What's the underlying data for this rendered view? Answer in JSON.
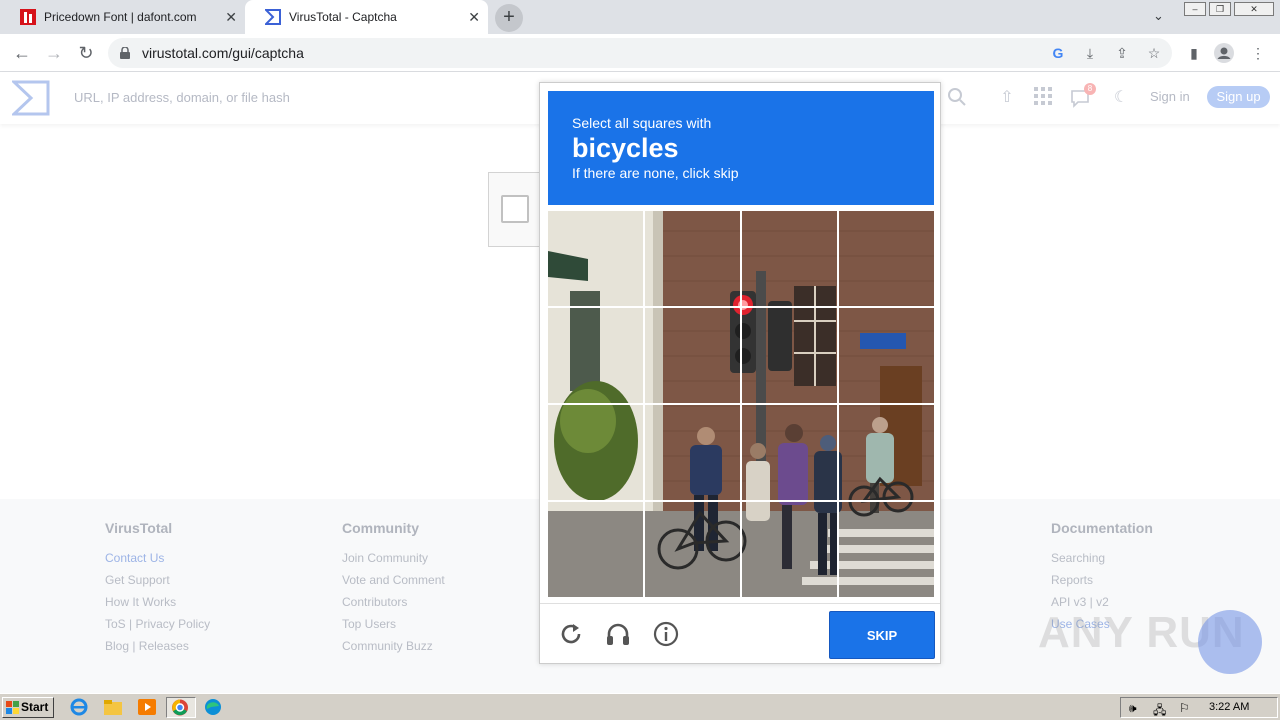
{
  "browser": {
    "tabs": [
      {
        "title": "Pricedown Font | dafont.com",
        "active": false
      },
      {
        "title": "VirusTotal - Captcha",
        "active": true
      }
    ],
    "url": "virustotal.com/gui/captcha"
  },
  "vt": {
    "search_placeholder": "URL, IP address, domain, or file hash",
    "notification_count": "8",
    "sign_in": "Sign in",
    "sign_up": "Sign up"
  },
  "footer": {
    "columns": [
      {
        "heading": "VirusTotal",
        "links": [
          "Contact Us",
          "Get Support",
          "How It Works",
          "ToS | Privacy Policy",
          "Blog | Releases"
        ]
      },
      {
        "heading": "Community",
        "links": [
          "Join Community",
          "Vote and Comment",
          "Contributors",
          "Top Users",
          "Community Buzz"
        ]
      },
      {
        "heading": "Documentation",
        "links": [
          "Searching",
          "Reports",
          "API v3 | v2",
          "Use Cases"
        ]
      }
    ]
  },
  "captcha": {
    "instruction": "Select all squares with",
    "target": "bicycles",
    "hint": "If there are none, click skip",
    "skip_label": "SKIP",
    "grid": "4x4"
  },
  "watermark": "ANY RUN",
  "taskbar": {
    "start_label": "Start",
    "clock": "3:22 AM"
  },
  "colors": {
    "captcha_blue": "#1a73e8",
    "taskbar": "#d4d0c8"
  }
}
